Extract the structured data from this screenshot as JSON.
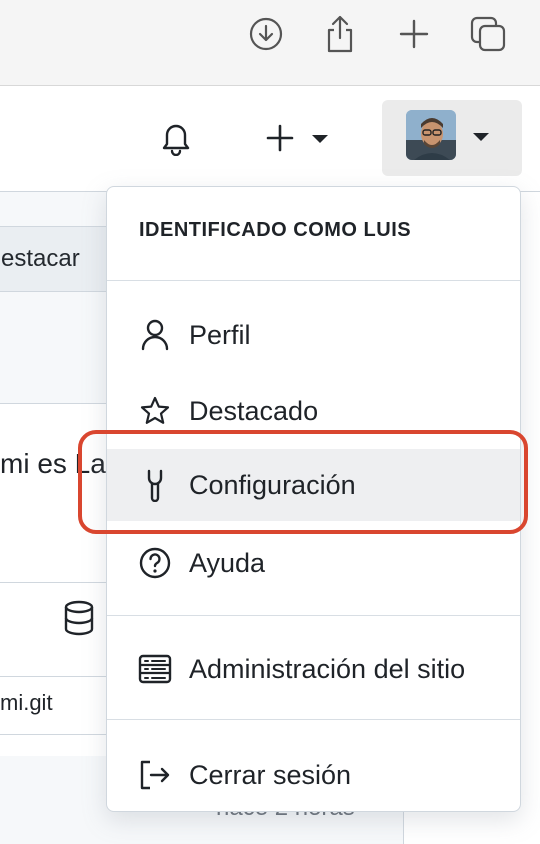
{
  "browser": {
    "icons": [
      "download-icon",
      "share-icon",
      "new-tab-icon",
      "tabs-overview-icon"
    ]
  },
  "header": {
    "icons": [
      "notification-bell-icon",
      "create-new-icon",
      "caret-down-icon"
    ],
    "avatar_alt": "avatar"
  },
  "background": {
    "star_button_label": "estacar",
    "repo_title": "mi es La",
    "file_label": "mi.git",
    "time_label": "hace 2 horas"
  },
  "menu": {
    "header": "IDENTIFICADO COMO LUIS",
    "items": [
      {
        "label": "Perfil",
        "icon": "person-icon"
      },
      {
        "label": "Destacado",
        "icon": "star-icon"
      },
      {
        "label": "Configuración",
        "icon": "tools-icon",
        "active": true
      },
      {
        "label": "Ayuda",
        "icon": "question-icon"
      },
      {
        "label": "Administración del sitio",
        "icon": "server-icon"
      },
      {
        "label": "Cerrar sesión",
        "icon": "sign-out-icon"
      }
    ]
  },
  "colors": {
    "highlight_outline": "#d9462f",
    "active_item_bg": "#eeeff1"
  }
}
